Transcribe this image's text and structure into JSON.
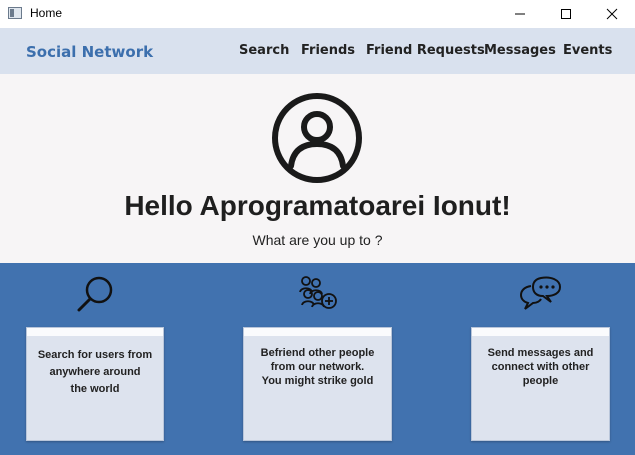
{
  "window": {
    "title": "Home"
  },
  "navbar": {
    "brand": "Social Network",
    "items": [
      {
        "label": "Search"
      },
      {
        "label": "Friends"
      },
      {
        "label": "Friend Requests"
      },
      {
        "label": "Messages"
      },
      {
        "label": "Events"
      }
    ]
  },
  "hero": {
    "greeting": "Hello Aprogramatoarei Ionut!",
    "subtitle": "What are you up to ?"
  },
  "features": [
    {
      "icon": "search-icon",
      "text_lines": [
        "Search for users from",
        "anywhere around",
        "the world"
      ]
    },
    {
      "icon": "add-group-icon",
      "text_lines": [
        "Befriend other people",
        "from our network.",
        "You might strike gold"
      ]
    },
    {
      "icon": "chat-icon",
      "text_lines": [
        "Send messages and",
        "connect with other",
        "people"
      ]
    }
  ],
  "colors": {
    "navbar": "#d9e1ee",
    "brand": "#3c6fad",
    "band": "#4172af",
    "card": "#dde3ee",
    "hero": "#f7f5f6"
  }
}
